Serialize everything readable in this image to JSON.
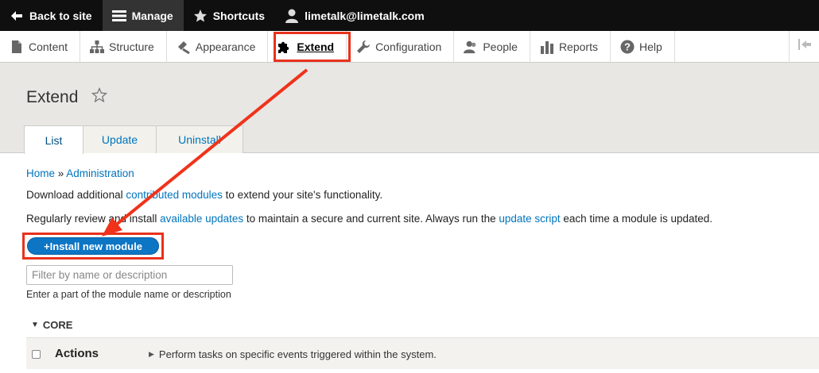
{
  "toolbar": {
    "back_label": "Back to site",
    "manage_label": "Manage",
    "shortcuts_label": "Shortcuts",
    "user_label": "limetalk@limetalk.com"
  },
  "tray": {
    "items": [
      {
        "label": "Content",
        "icon": "document-icon"
      },
      {
        "label": "Structure",
        "icon": "sitemap-icon"
      },
      {
        "label": "Appearance",
        "icon": "brush-icon"
      },
      {
        "label": "Extend",
        "icon": "puzzle-icon"
      },
      {
        "label": "Configuration",
        "icon": "wrench-icon"
      },
      {
        "label": "People",
        "icon": "people-icon"
      },
      {
        "label": "Reports",
        "icon": "bar-chart-icon"
      },
      {
        "label": "Help",
        "icon": "help-icon"
      }
    ],
    "active": "Extend"
  },
  "header": {
    "title": "Extend",
    "tabs": [
      "List",
      "Update",
      "Uninstall"
    ],
    "active_tab": "List"
  },
  "breadcrumb": {
    "home": "Home",
    "sep": " » ",
    "admin": "Administration"
  },
  "intro": {
    "line1_pre": "Download additional ",
    "line1_link": "contributed modules",
    "line1_post": " to extend your site's functionality.",
    "line2_pre": "Regularly review and install ",
    "line2_link1": "available updates",
    "line2_mid": " to maintain a secure and current site. Always run the ",
    "line2_link2": "update script",
    "line2_post": " each time a module is updated."
  },
  "install_button": "+Install new module",
  "filter": {
    "placeholder": "Filter by name or description",
    "description": "Enter a part of the module name or description"
  },
  "core_label": "CORE",
  "modules": [
    {
      "name": "Actions",
      "description": "Perform tasks on specific events triggered within the system."
    }
  ],
  "colors": {
    "highlight": "#e8321c",
    "link": "#0074bd",
    "button": "#0c75c4"
  }
}
